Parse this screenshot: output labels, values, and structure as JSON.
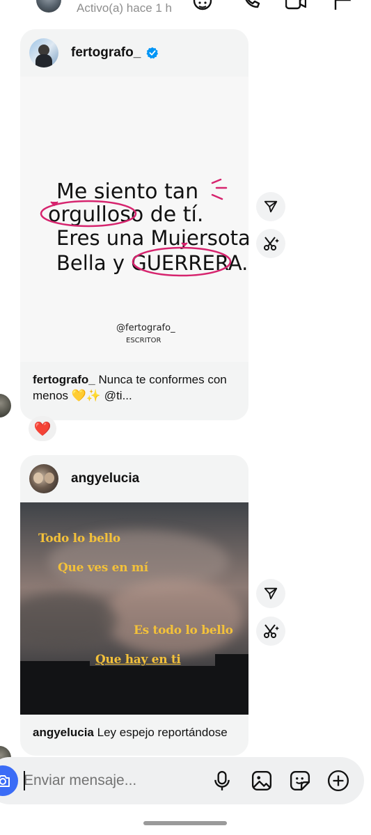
{
  "header": {
    "status": "Activo(a) hace 1 h",
    "icons": [
      "sticker-icon",
      "phone-icon",
      "video-icon",
      "flag-icon"
    ]
  },
  "posts": [
    {
      "username": "fertografo_",
      "verified": true,
      "image_text": {
        "line1": "Me siento tan",
        "line2": "orgulloso de tí.",
        "line3": "Eres una Mujersota.",
        "line4": "Bella y GUERRERA.",
        "signature": "@fertografo_",
        "signature_sub": "ESCRITOR"
      },
      "caption_user": "fertografo_",
      "caption_text": "Nunca te conformes con menos 💛✨ @ti..."
    },
    {
      "username": "angyelucia",
      "verified": false,
      "image_text": {
        "line1": "Todo lo bello",
        "line2": "Que ves en mí",
        "line3": "Es todo lo bello",
        "line4": "Que hay en ti"
      },
      "caption_user": "angyelucia",
      "caption_text": "Ley espejo reportándose"
    }
  ],
  "reaction": "❤️",
  "composer": {
    "placeholder": "Enviar mensaje...",
    "icons": [
      "camera-icon",
      "microphone-icon",
      "gallery-icon",
      "sticker-icon",
      "plus-icon"
    ]
  },
  "colors": {
    "card_bg": "#f3f4f4",
    "accent_blue": "#3b6cf6",
    "verified_blue": "#0095f6",
    "heart_red": "#e8334a",
    "image_magenta": "#d6246e",
    "image_yellow": "#f3c13a"
  }
}
